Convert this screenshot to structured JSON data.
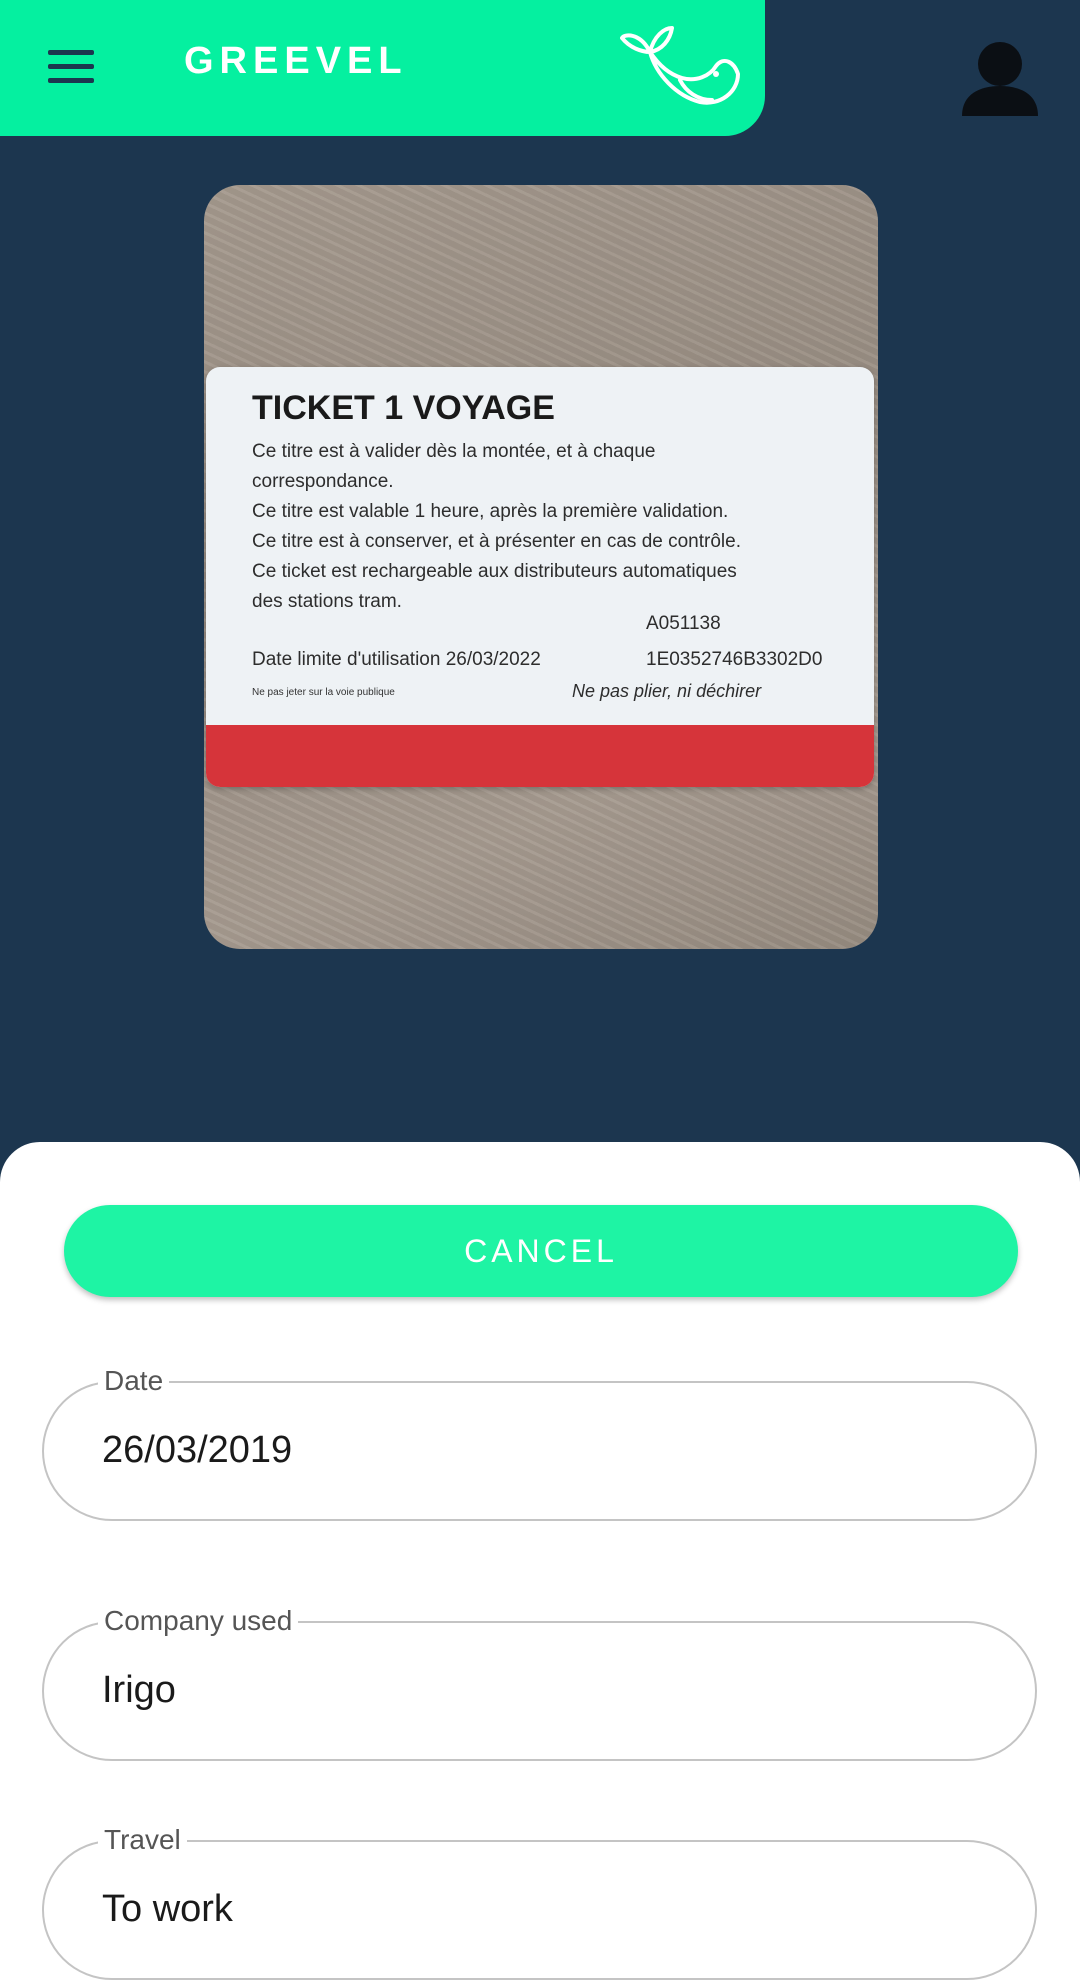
{
  "app": {
    "title": "GREEVEL",
    "accent_color": "#05f0a0",
    "background_color": "#1c364f"
  },
  "header": {
    "menu_icon": "hamburger-menu-icon",
    "logo_icon": "whale-leaf-logo-icon",
    "profile_icon": "person-icon"
  },
  "ticket": {
    "title": "TICKET 1 VOYAGE",
    "lines": [
      "Ce titre est à valider dès la montée, et à chaque",
      "correspondance.",
      "Ce titre est valable 1 heure, après la première validation.",
      "Ce titre est à conserver, et à présenter en cas de contrôle.",
      "Ce ticket est rechargeable aux distributeurs automatiques",
      "des stations tram."
    ],
    "serial": "A051138",
    "expiry": "Date limite d'utilisation 26/03/2022",
    "code": "1E0352746B3302D0",
    "small_text": "Ne pas jeter sur la voie publique",
    "fold_notice": "Ne pas plier, ni déchirer"
  },
  "form": {
    "cancel_label": "CANCEL",
    "fields": [
      {
        "label": "Date",
        "value": "26/03/2019"
      },
      {
        "label": "Company used",
        "value": "Irigo"
      },
      {
        "label": "Travel",
        "value": "To work"
      }
    ]
  }
}
